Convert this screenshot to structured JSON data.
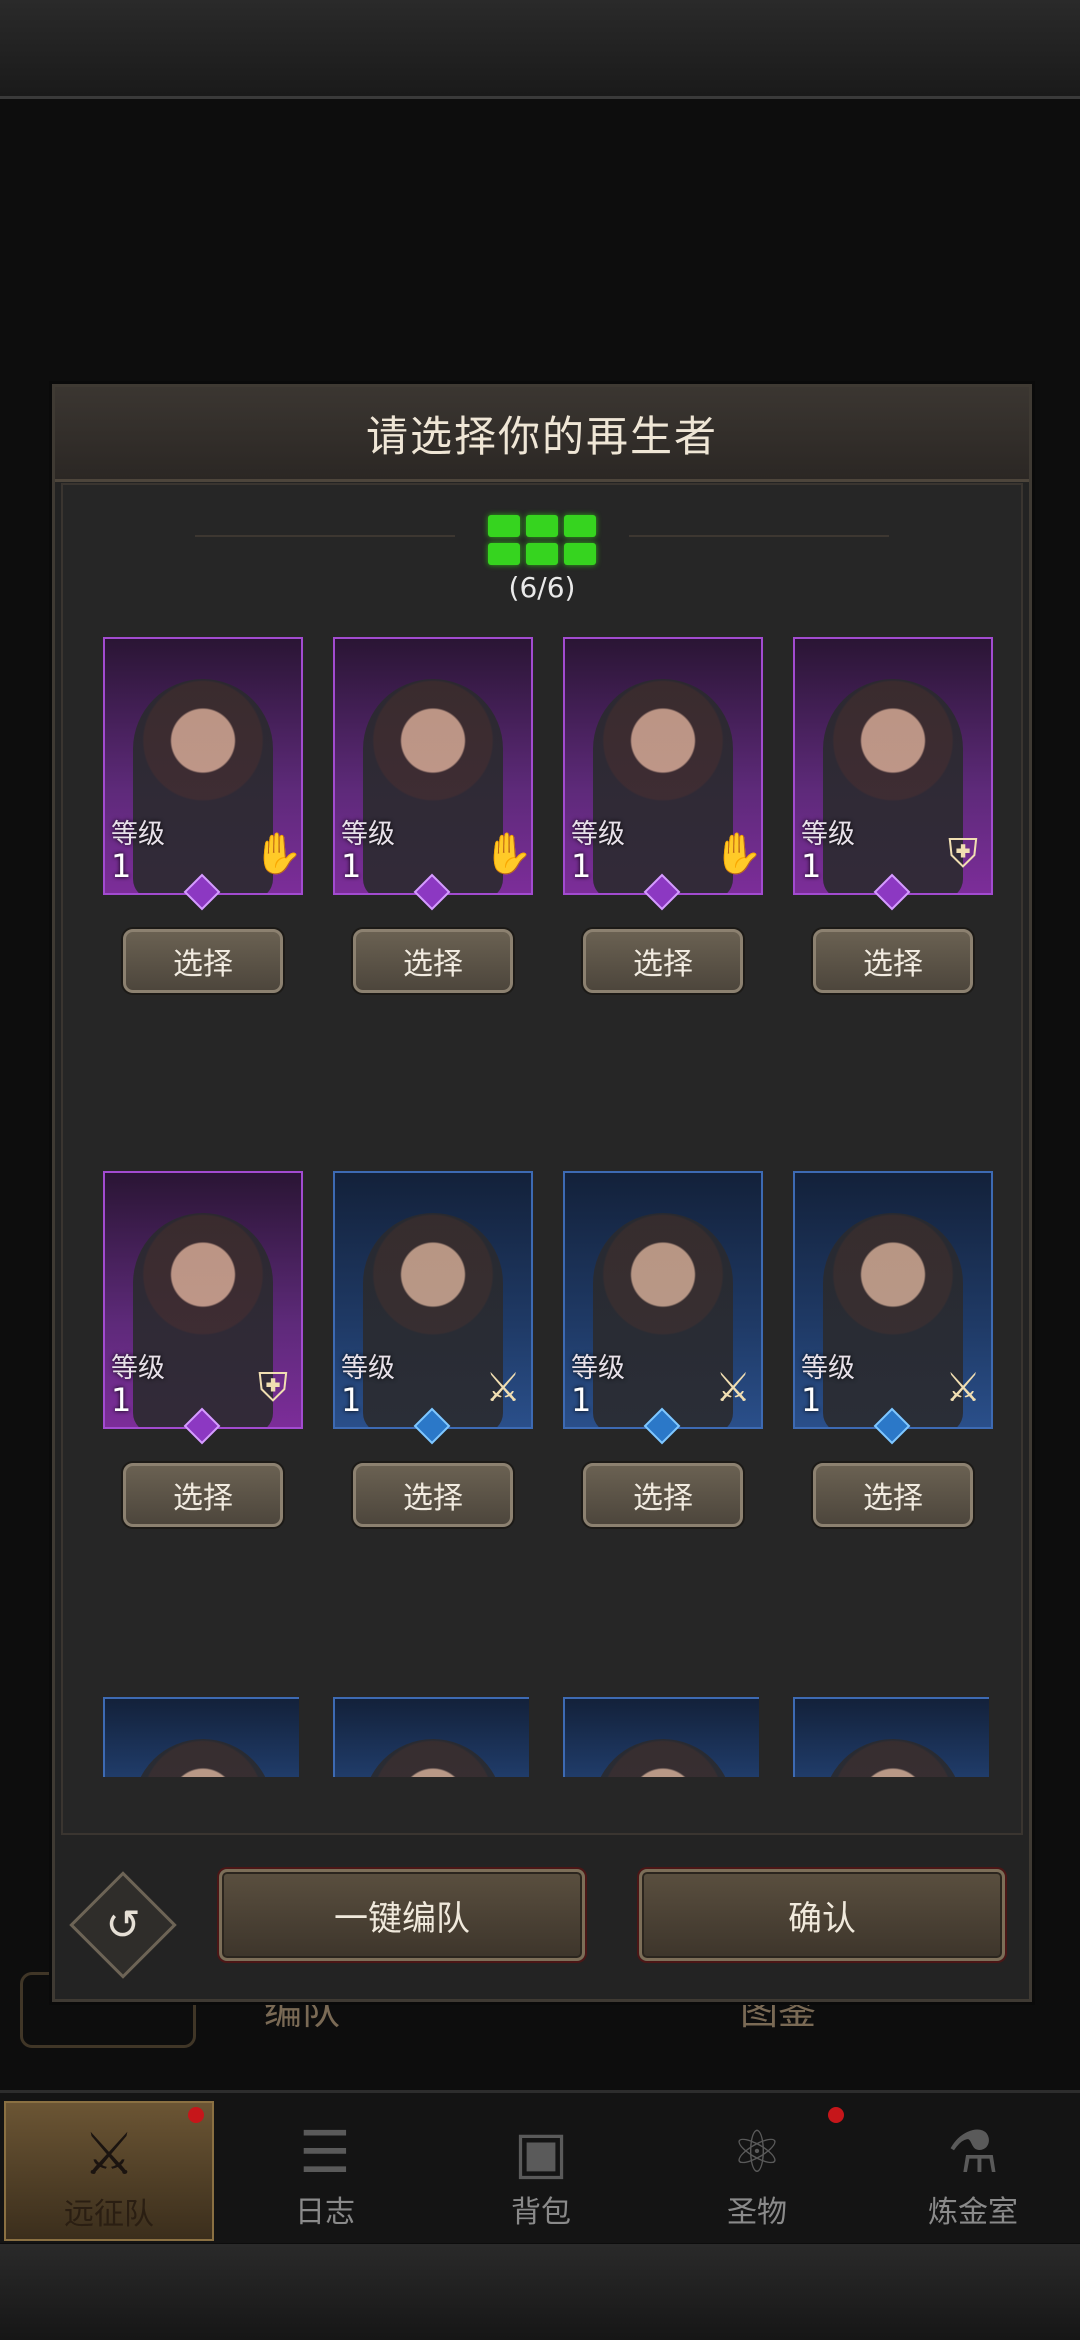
{
  "modal": {
    "title": "请选择你的再生者",
    "capacity_text": "(6/6)",
    "slots_filled": 6,
    "slots_total": 6
  },
  "heroes": [
    {
      "level_label": "等级",
      "level": "1",
      "rarity": "purple",
      "class_icon": "hand-icon",
      "select_label": "选择"
    },
    {
      "level_label": "等级",
      "level": "1",
      "rarity": "purple",
      "class_icon": "hand-icon",
      "select_label": "选择"
    },
    {
      "level_label": "等级",
      "level": "1",
      "rarity": "purple",
      "class_icon": "hand-icon",
      "select_label": "选择"
    },
    {
      "level_label": "等级",
      "level": "1",
      "rarity": "purple",
      "class_icon": "shield-icon",
      "select_label": "选择"
    },
    {
      "level_label": "等级",
      "level": "1",
      "rarity": "purple",
      "class_icon": "shield-icon",
      "select_label": "选择"
    },
    {
      "level_label": "等级",
      "level": "1",
      "rarity": "blue",
      "class_icon": "sword-icon",
      "select_label": "选择"
    },
    {
      "level_label": "等级",
      "level": "1",
      "rarity": "blue",
      "class_icon": "sword-icon",
      "select_label": "选择"
    },
    {
      "level_label": "等级",
      "level": "1",
      "rarity": "blue",
      "class_icon": "sword-icon",
      "select_label": "选择"
    }
  ],
  "footer": {
    "auto_team_label": "一键编队",
    "confirm_label": "确认"
  },
  "background_tabs": {
    "formation": "编队",
    "codex": "图鉴"
  },
  "bottom_nav": [
    {
      "label": "远征队",
      "icon": "viking-helmet-icon",
      "active": true
    },
    {
      "label": "日志",
      "icon": "scroll-icon",
      "active": false
    },
    {
      "label": "背包",
      "icon": "backpack-icon",
      "active": false
    },
    {
      "label": "圣物",
      "icon": "chalice-icon",
      "active": false
    },
    {
      "label": "炼金室",
      "icon": "alchemy-icon",
      "active": false
    }
  ],
  "colors": {
    "slot_green": "#36d41f",
    "rarity_purple": "#a24bd0",
    "rarity_blue": "#3d6ab3",
    "notification_red": "#c6161a"
  }
}
